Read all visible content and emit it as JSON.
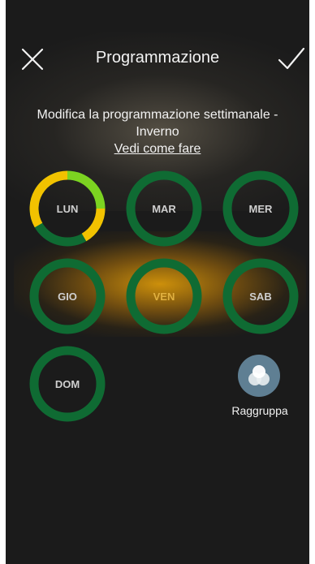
{
  "header": {
    "title": "Programmazione",
    "close_icon": "close-icon",
    "confirm_icon": "check-icon"
  },
  "subtitle": "Modifica la programmazione settimanale - Inverno",
  "help_link": "Vedi come fare",
  "days": [
    {
      "label": "LUN"
    },
    {
      "label": "MAR"
    },
    {
      "label": "MER"
    },
    {
      "label": "GIO"
    },
    {
      "label": "VEN"
    },
    {
      "label": "SAB"
    },
    {
      "label": "DOM"
    }
  ],
  "group_button": {
    "label": "Raggruppa",
    "icon": "group-circles-icon"
  },
  "colors": {
    "background": "#1b1b1b",
    "ring_green": "#0f6b33",
    "ring_yellow": "#f2c200",
    "ring_lightgreen": "#7cd321",
    "glow_orange": "#d6960a",
    "group_button_bg": "#5f7f93"
  }
}
